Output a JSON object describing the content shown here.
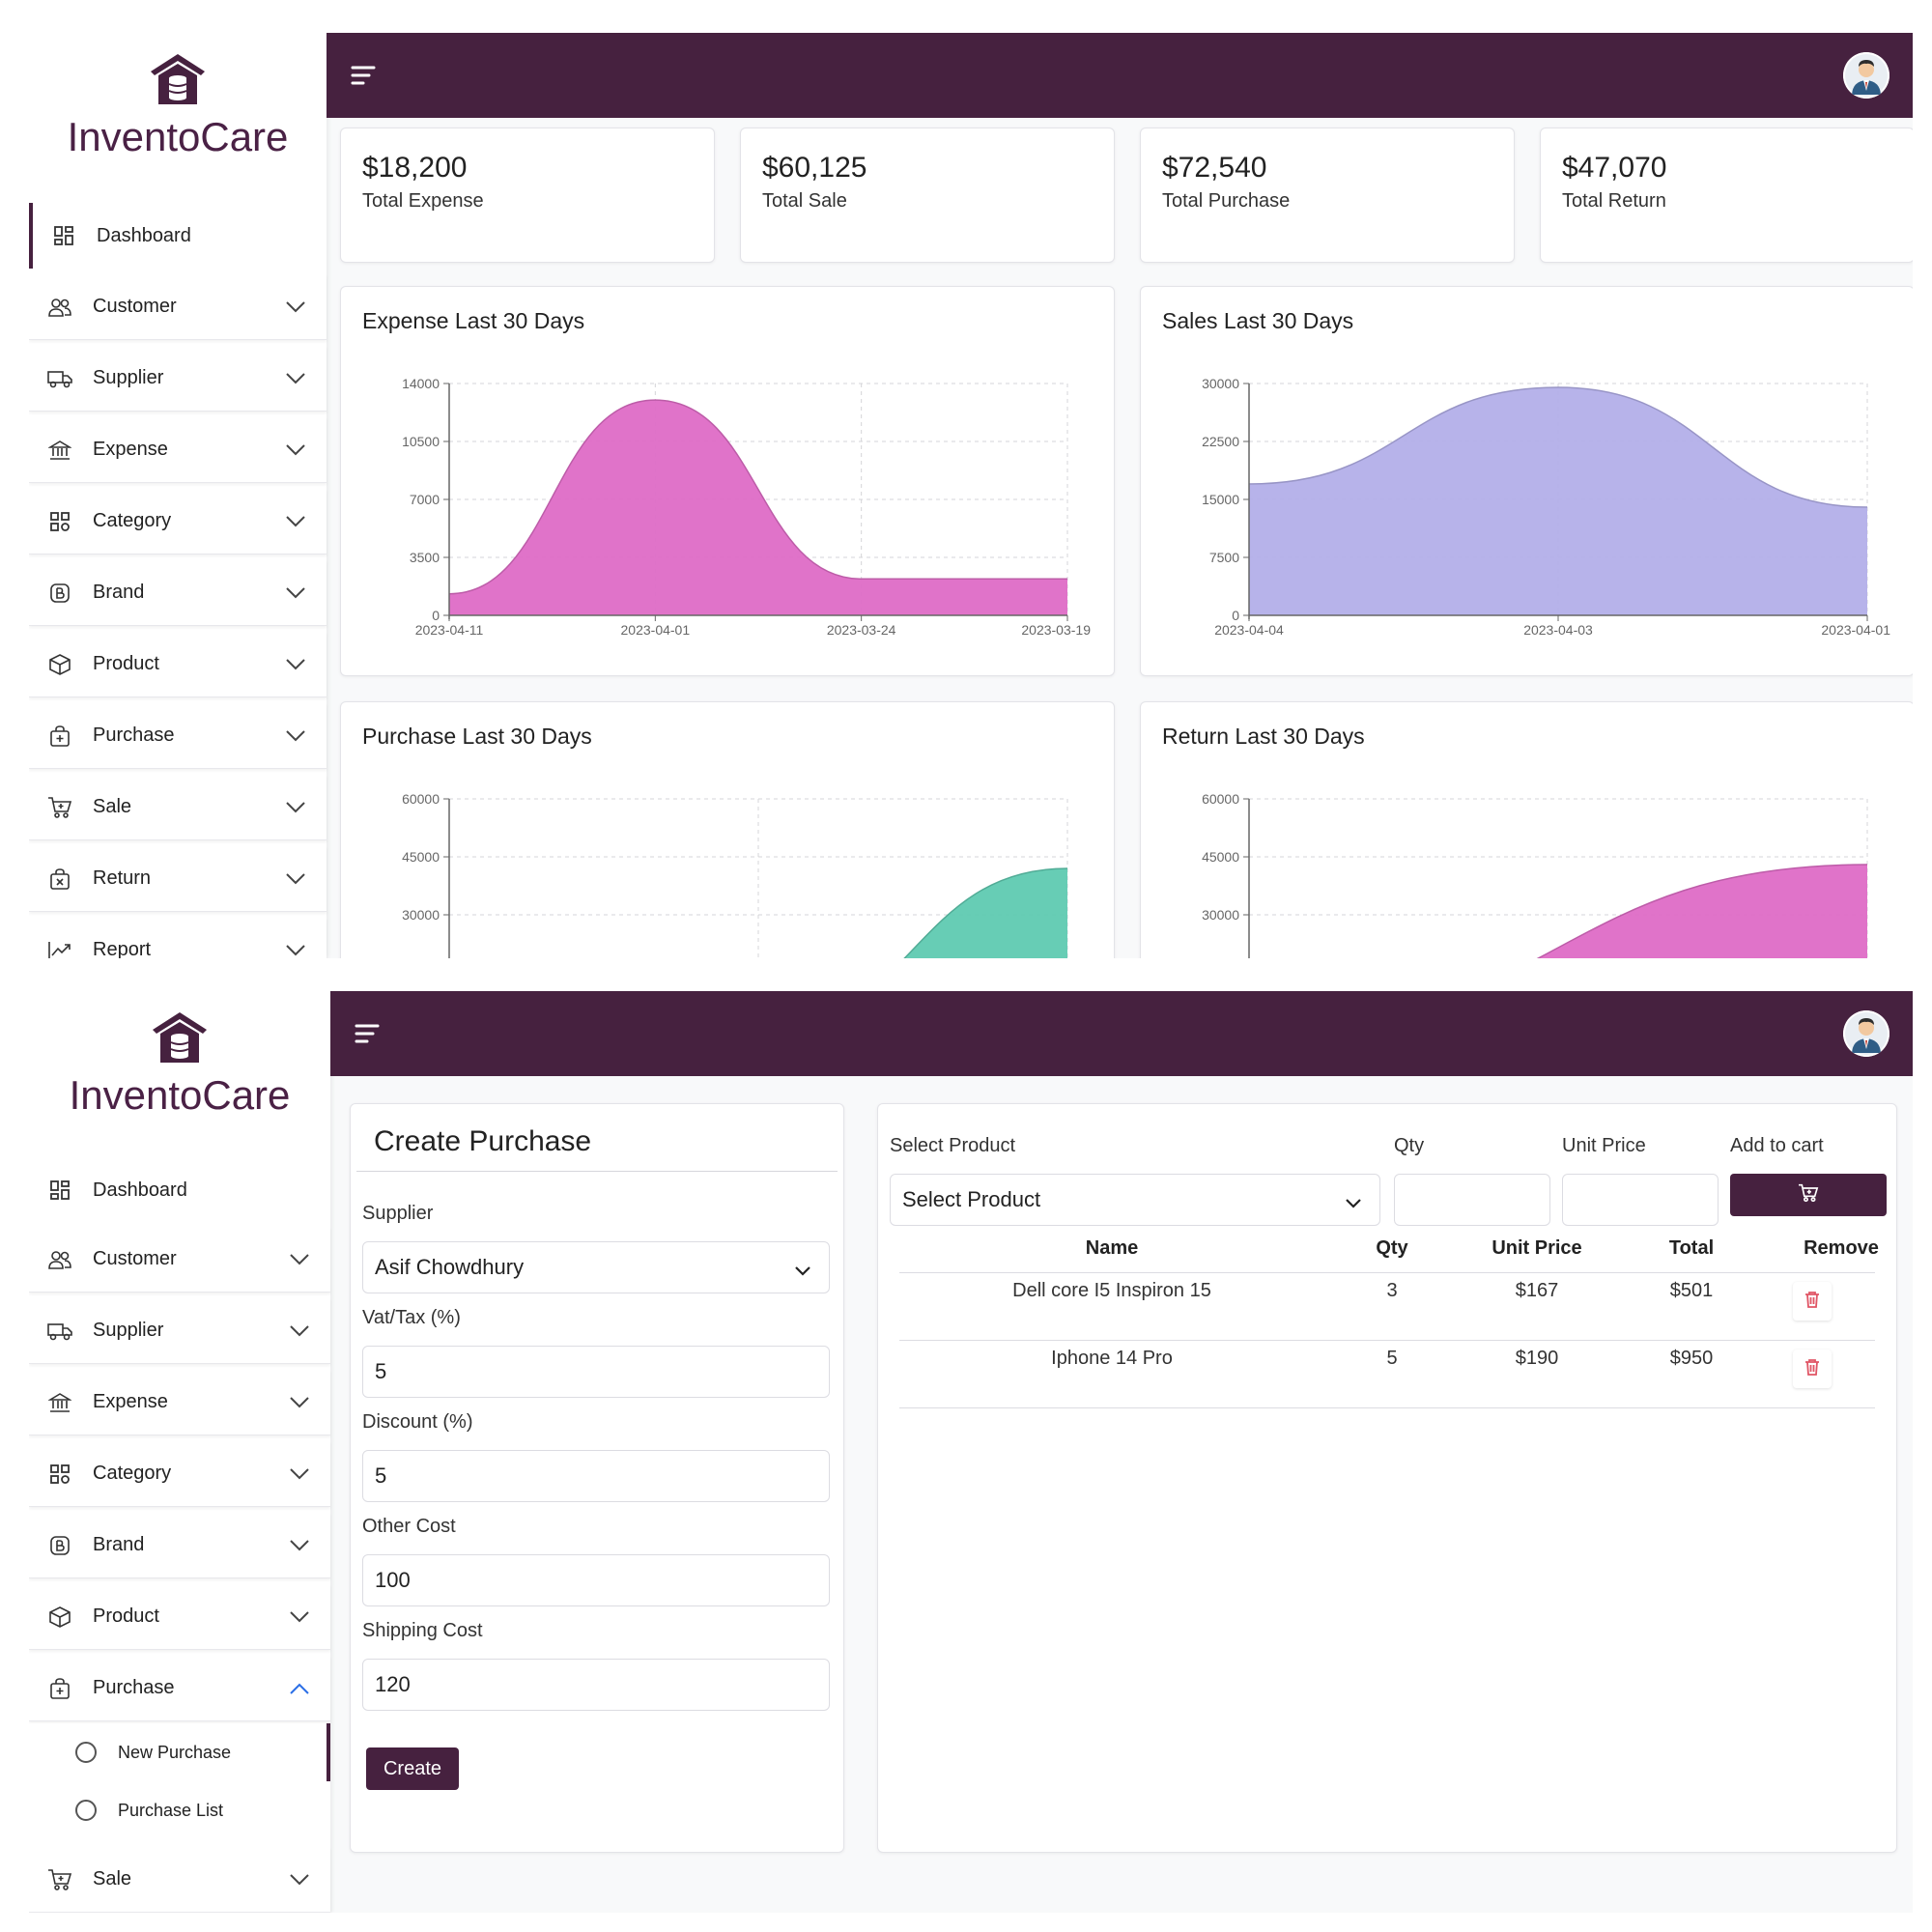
{
  "app": {
    "name": "InventoCare"
  },
  "nav": {
    "dashboard": "Dashboard",
    "customer": "Customer",
    "supplier": "Supplier",
    "expense": "Expense",
    "category": "Category",
    "brand": "Brand",
    "product": "Product",
    "purchase": "Purchase",
    "sale": "Sale",
    "return": "Return",
    "report": "Report",
    "new_purchase": "New Purchase",
    "purchase_list": "Purchase List"
  },
  "stats": [
    {
      "value": "$18,200",
      "label": "Total Expense"
    },
    {
      "value": "$60,125",
      "label": "Total Sale"
    },
    {
      "value": "$72,540",
      "label": "Total Purchase"
    },
    {
      "value": "$47,070",
      "label": "Total Return"
    }
  ],
  "colors": {
    "brand": "#46213f",
    "expense_area": "#de6cc6",
    "sales_area": "#b3afe9",
    "purchase_area": "#5fcab1",
    "return_area": "#de6cc6",
    "trash": "#e05565"
  },
  "chart_data": [
    {
      "type": "area",
      "title": "Expense Last 30 Days",
      "x": [
        "2023-04-11",
        "2023-04-01",
        "2023-03-24",
        "2023-03-19"
      ],
      "y": [
        1300,
        13000,
        2200,
        2200
      ],
      "ylim": [
        0,
        14000
      ],
      "yticks": [
        0,
        3500,
        7000,
        10500,
        14000
      ],
      "grid": true
    },
    {
      "type": "area",
      "title": "Sales Last 30 Days",
      "x": [
        "2023-04-04",
        "2023-04-03",
        "2023-04-01"
      ],
      "y": [
        17000,
        29500,
        14000
      ],
      "ylim": [
        0,
        30000
      ],
      "yticks": [
        0,
        7500,
        15000,
        22500,
        30000
      ],
      "grid": true
    },
    {
      "type": "area",
      "title": "Purchase Last 30 Days",
      "x": [
        "",
        "",
        ""
      ],
      "y": [
        0,
        0,
        42000
      ],
      "ylim": [
        0,
        60000
      ],
      "yticks": [
        30000,
        45000,
        60000
      ],
      "grid": true
    },
    {
      "type": "area",
      "title": "Return Last 30 Days",
      "x": [
        "",
        ""
      ],
      "y": [
        0,
        43000
      ],
      "ylim": [
        0,
        60000
      ],
      "yticks": [
        30000,
        45000,
        60000
      ],
      "grid": true
    }
  ],
  "purchase_form": {
    "title": "Create Purchase",
    "supplier_label": "Supplier",
    "supplier_value": "Asif Chowdhury",
    "vat_label": "Vat/Tax (%)",
    "vat_value": "5",
    "discount_label": "Discount (%)",
    "discount_value": "5",
    "other_label": "Other Cost",
    "other_value": "100",
    "shipping_label": "Shipping Cost",
    "shipping_value": "120",
    "create_button": "Create"
  },
  "cart": {
    "select_product_label": "Select Product",
    "select_product_value": "Select Product",
    "qty_label": "Qty",
    "unit_price_label": "Unit Price",
    "add_to_cart_label": "Add to cart",
    "columns": [
      "Name",
      "Qty",
      "Unit Price",
      "Total",
      "Remove"
    ],
    "rows": [
      {
        "name": "Dell core I5 Inspiron 15",
        "qty": "3",
        "unit_price": "$167",
        "total": "$501"
      },
      {
        "name": "Iphone 14 Pro",
        "qty": "5",
        "unit_price": "$190",
        "total": "$950"
      }
    ]
  }
}
